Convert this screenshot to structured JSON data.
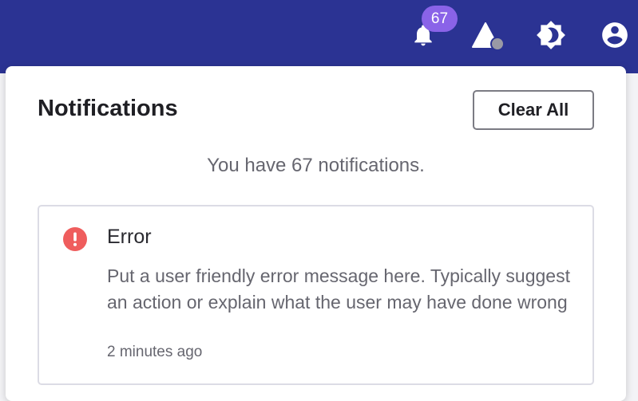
{
  "header": {
    "notification_count": "67",
    "icons": [
      "bell-icon",
      "alert-triangle-icon",
      "brightness-icon",
      "account-circle-icon"
    ],
    "colors": {
      "bar": "#2b3393",
      "badge": "#8a63e8",
      "status_dot": "#9a9aa5"
    }
  },
  "panel": {
    "title": "Notifications",
    "clear_all_label": "Clear All",
    "summary": "You have 67 notifications.",
    "notifications": [
      {
        "type": "error",
        "icon": "error-circle-icon",
        "icon_color": "#ef5d5d",
        "title": "Error",
        "message": "Put a user friendly error message here. Typically suggest an action or explain what the user may have done wrong",
        "time": "2 minutes ago"
      }
    ]
  }
}
